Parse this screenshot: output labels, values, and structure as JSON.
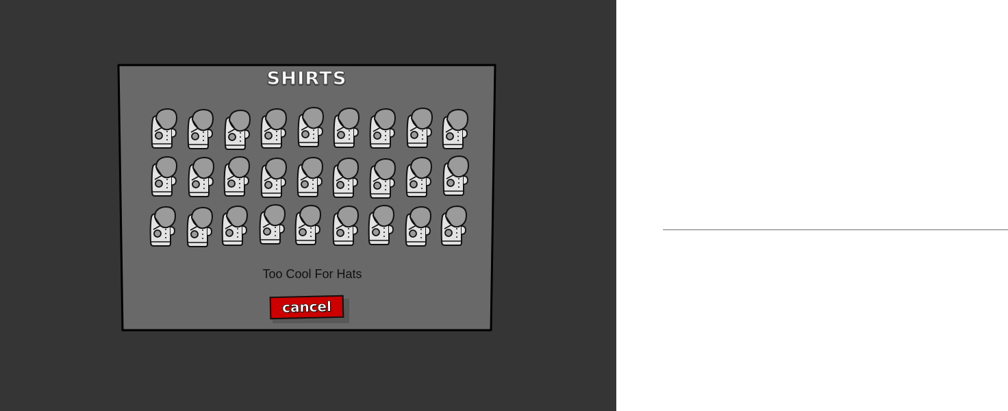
{
  "panel": {
    "title": "SHIRTS",
    "item_name": "Too Cool For Hats",
    "cancel_label": "cancel"
  },
  "shirts": {
    "rows": 3,
    "columns": 9,
    "count": 27,
    "icon": "shirt-icon"
  },
  "colors": {
    "game_background": "#353535",
    "panel_fill": "#696969",
    "cancel_button": "#cc0000"
  }
}
